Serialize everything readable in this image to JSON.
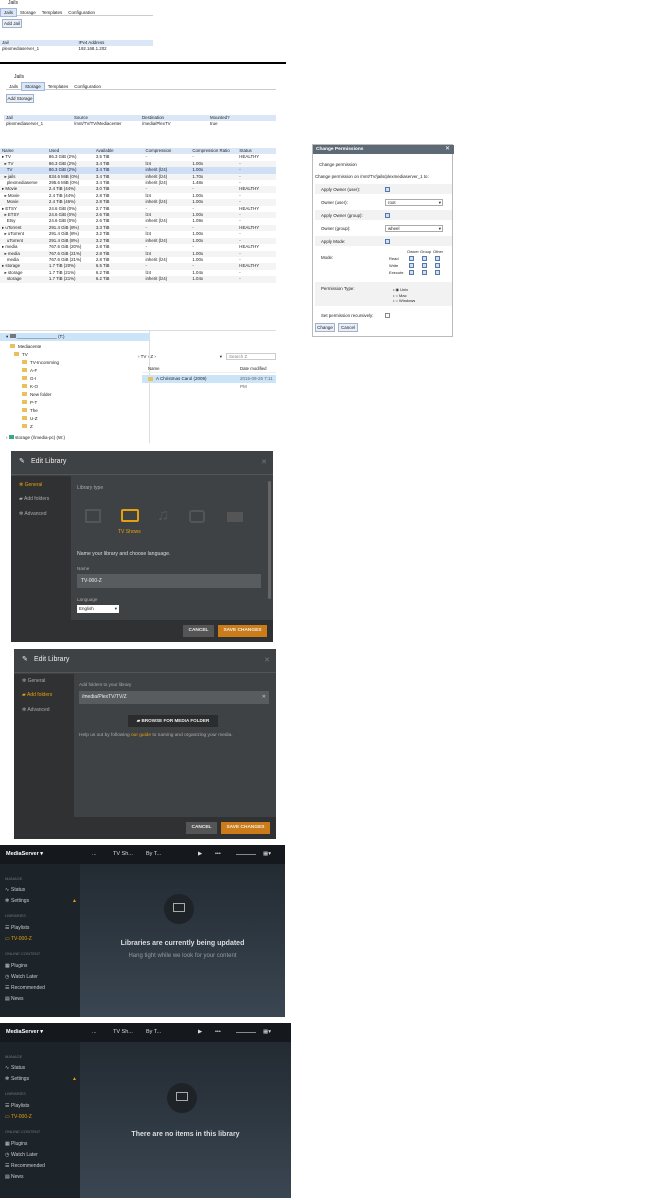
{
  "s1": {
    "title": "Jails",
    "tabs": [
      "Jails",
      "Storage",
      "Templates",
      "Configuration"
    ],
    "add_button": "Add Jail",
    "columns": [
      "Jail",
      "IPv4 Address"
    ],
    "rows": [
      [
        "plexmediaserver_1",
        "192.168.1.202"
      ]
    ]
  },
  "s2": {
    "title": "Jails",
    "tabs": [
      "Jails",
      "Storage",
      "Templates",
      "Configuration"
    ],
    "add_button": "Add Storage",
    "columns": [
      "Jail",
      "Source",
      "Destination",
      "Mounted?"
    ],
    "rows": [
      [
        "plexmediaserver_1",
        "/mnt/TV/TV/Mediacenter",
        "/media/PlexTV",
        "true"
      ]
    ]
  },
  "s3": {
    "columns": [
      "Name",
      "Used",
      "Available",
      "Compression",
      "Compression Ratio",
      "Status"
    ],
    "rows": [
      [
        "▸ TV",
        "86.3 GiB (2%)",
        "3.5 TiB",
        "-",
        "-",
        "HEALTHY"
      ],
      [
        "  ▸ TV",
        "86.3 GiB (2%)",
        "3.4 TiB",
        "lz4",
        "1.00x",
        "-"
      ],
      [
        "    TV",
        "86.3 GiB (2%)",
        "3.4 TiB",
        "inherit (lz4)",
        "1.00x",
        "-"
      ],
      [
        "  ▸ jails",
        "834.6 MiB (0%)",
        "3.4 TiB",
        "inherit (lz4)",
        "1.70x",
        "-"
      ],
      [
        "    plexmediaserve",
        "295.6 MiB (0%)",
        "3.4 TiB",
        "inherit (lz4)",
        "1.48x",
        "-"
      ],
      [
        "▸ Movie",
        "2.4 TiB (44%)",
        "3.0 TiB",
        "-",
        "-",
        "HEALTHY"
      ],
      [
        "  ▸ Movie",
        "2.4 TiB (44%)",
        "2.8 TiB",
        "lz4",
        "1.00x",
        "-"
      ],
      [
        "    Movie",
        "2.4 TiB (46%)",
        "2.8 TiB",
        "inherit (lz4)",
        "1.00x",
        "-"
      ],
      [
        "▸ ETSY",
        "24.6 GiB (0%)",
        "2.7 TiB",
        "-",
        "-",
        "HEALTHY"
      ],
      [
        "  ▸ ETSY",
        "24.6 GiB (0%)",
        "2.6 TiB",
        "lz4",
        "1.00x",
        "-"
      ],
      [
        "    Etsy",
        "24.6 GiB (0%)",
        "2.6 TiB",
        "inherit (lz4)",
        "1.09x",
        "-"
      ],
      [
        "▸ uTorrent",
        "291.4 GiB (8%)",
        "3.3 TiB",
        "-",
        "-",
        "HEALTHY"
      ],
      [
        "  ▸ uTorrent",
        "291.4 GiB (8%)",
        "3.2 TiB",
        "lz4",
        "1.00x",
        "-"
      ],
      [
        "    uTorrent",
        "291.4 GiB (8%)",
        "3.2 TiB",
        "inherit (lz4)",
        "1.00x",
        "-"
      ],
      [
        "▸ media",
        "767.6 GiB (20%)",
        "2.8 TiB",
        "-",
        "-",
        "HEALTHY"
      ],
      [
        "  ▸ media",
        "767.6 GiB (21%)",
        "2.8 TiB",
        "lz4",
        "1.00x",
        "-"
      ],
      [
        "    media",
        "767.6 GiB (21%)",
        "2.8 TiB",
        "inherit (lz4)",
        "1.00x",
        "-"
      ],
      [
        "▸ storage",
        "1.7 TiB (20%)",
        "6.5 TiB",
        "-",
        "-",
        "HEALTHY"
      ],
      [
        "  ▸ storage",
        "1.7 TiB (21%)",
        "6.2 TiB",
        "lz4",
        "1.04x",
        "-"
      ],
      [
        "    storage",
        "1.7 TiB (21%)",
        "6.2 TiB",
        "inherit (lz4)",
        "1.04x",
        "-"
      ]
    ]
  },
  "perm": {
    "title": "Change Permissions",
    "subtitle": "Change permission",
    "path_line": "Change permission on /mnt/TV/jails/plexmediaserver_1 to:",
    "apply_owner_user": "Apply Owner (user):",
    "owner_user_label": "Owner (user):",
    "owner_user_value": "root",
    "apply_owner_group": "Apply Owner (group):",
    "owner_group_label": "Owner (group):",
    "owner_group_value": "wheel",
    "apply_mode": "Apply Mode:",
    "mode_label": "Mode:",
    "mode_cols": [
      "Owner",
      "Group",
      "Other"
    ],
    "mode_rows": [
      "Read",
      "Write",
      "Execute"
    ],
    "permission_type_label": "Permission Type:",
    "permission_types": [
      "Unix",
      "Mac",
      "Windows"
    ],
    "recursive_label": "Set permission recursively:",
    "change_button": "Change",
    "cancel_button": "Cancel"
  },
  "explorer": {
    "tree_root": "(T:)",
    "tree": [
      "Mediacente",
      "TV",
      "TV-Incomming",
      "A-F",
      "G-I",
      "K-O",
      "New folder",
      "P-T",
      "The",
      "U-Z",
      "Z"
    ],
    "tree_bottom": "storage (\\\\media-pc) (W:)",
    "breadcrumb": "› TV › Z ›",
    "search_placeholder": "Search Z",
    "col_name": "Name",
    "col_date": "Date modified",
    "file_name": "A Christmas Carol (2009)",
    "file_date": "2015-09-26 7:11 PM"
  },
  "edit1": {
    "title": "Edit Library",
    "nav": [
      "General",
      "Add folders",
      "Advanced"
    ],
    "library_type_label": "Library type",
    "selected_type": "TV Shows",
    "name_heading": "Name your library and choose language.",
    "name_label": "Name",
    "name_value": "TV-000-Z",
    "language_label": "Language",
    "language_value": "English",
    "cancel": "CANCEL",
    "save": "SAVE CHANGES"
  },
  "edit2": {
    "title": "Edit Library",
    "nav": [
      "General",
      "Add folders",
      "Advanced"
    ],
    "add_label": "Add folders to your library",
    "folder_value": "/media/PlexTV/TV/Z",
    "browse": "BROWSE FOR MEDIA FOLDER",
    "help_before": "Help us out by following ",
    "help_link": "our guide",
    "help_after": " to naming and organizing your media.",
    "cancel": "CANCEL",
    "save": "SAVE CHANGES"
  },
  "ms1": {
    "server": "MediaServer ▾",
    "top": [
      "...",
      "TV Sh...",
      "By T..."
    ],
    "sections": {
      "manage": "MANAGE",
      "libraries": "LIBRARIES",
      "online": "ONLINE CONTENT"
    },
    "manage": [
      "Status",
      "Settings"
    ],
    "libraries": [
      "Playlists",
      "TV-000-Z"
    ],
    "online": [
      "Plugins",
      "Watch Later",
      "Recommended",
      "News"
    ],
    "message": "Libraries are currently being updated",
    "submessage": "Hang tight while we look for your content"
  },
  "ms2": {
    "server": "MediaServer ▾",
    "top": [
      "...",
      "TV Sh...",
      "By T..."
    ],
    "sections": {
      "manage": "MANAGE",
      "libraries": "LIBRARIES",
      "online": "ONLINE CONTENT"
    },
    "manage": [
      "Status",
      "Settings"
    ],
    "libraries": [
      "Playlists",
      "TV-000-Z"
    ],
    "online": [
      "Plugins",
      "Watch Later",
      "Recommended",
      "News"
    ],
    "message": "There are no items in this library"
  },
  "colors": {
    "accent": "#e5a00d",
    "plex_bg": "#3f4245",
    "freenas_header": "#dbe7f7"
  }
}
